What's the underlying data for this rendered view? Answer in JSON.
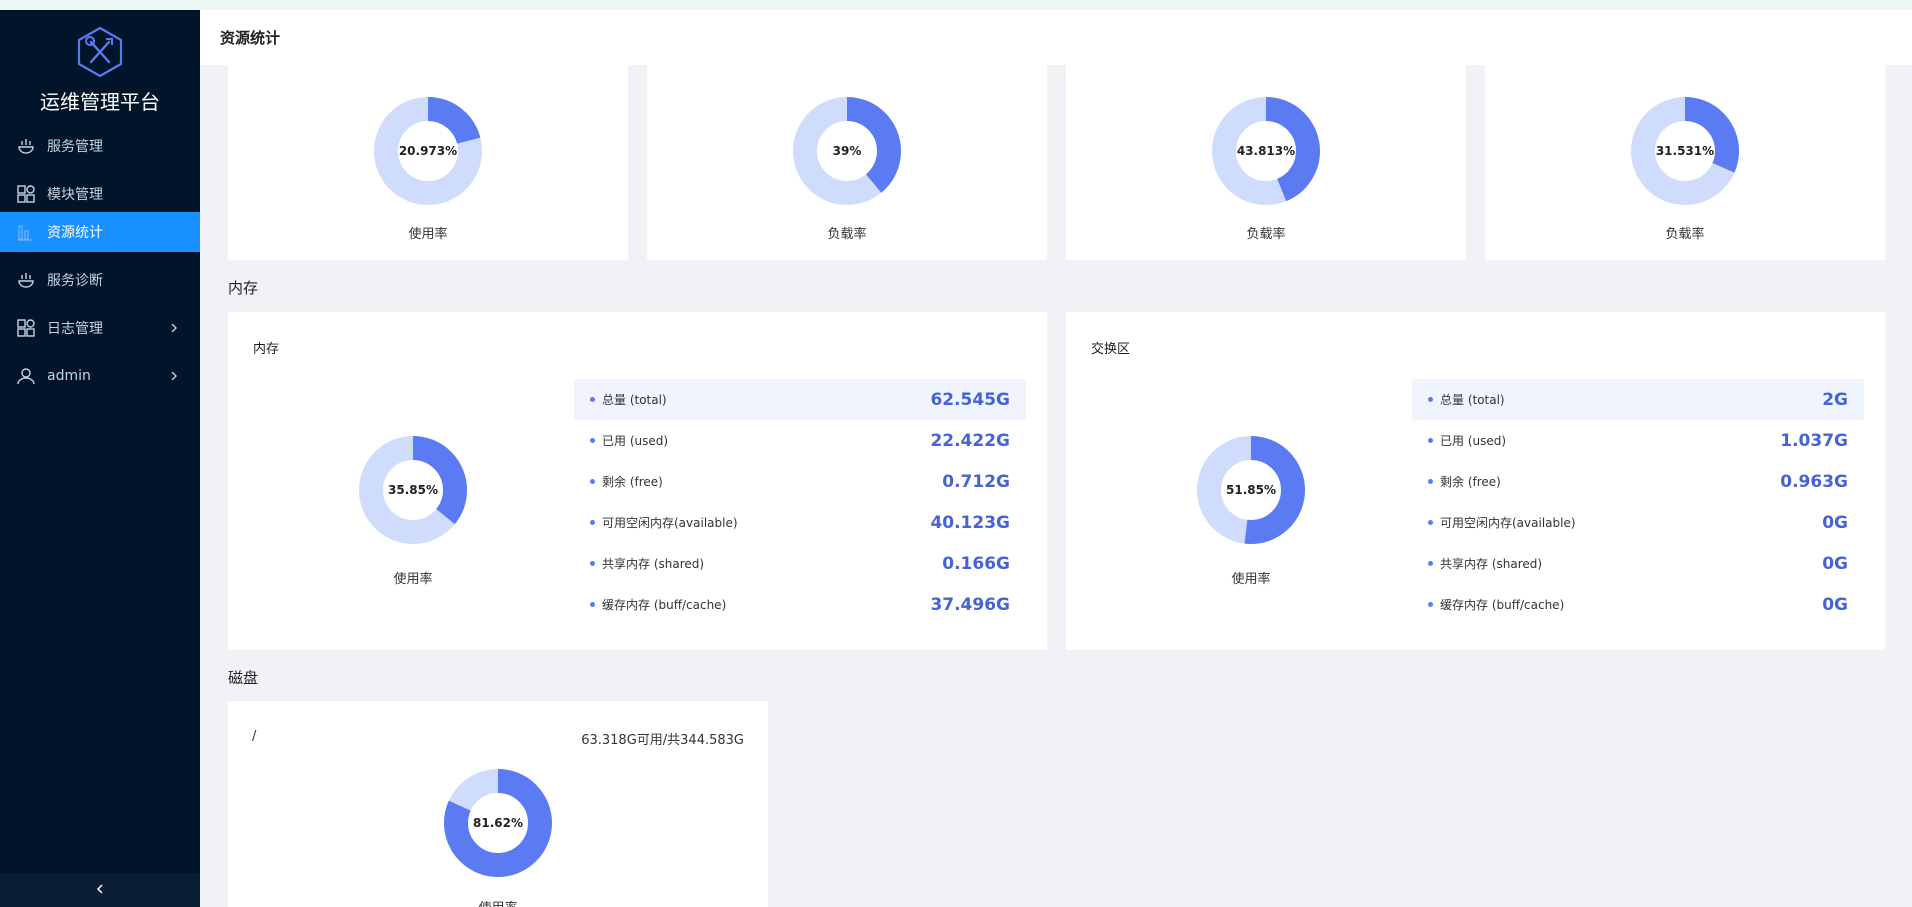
{
  "app": {
    "title": "运维管理平台"
  },
  "sidebar": {
    "items": [
      {
        "label": "服务管理",
        "icon": "service-icon"
      },
      {
        "label": "模块管理",
        "icon": "module-grid-icon"
      },
      {
        "label": "资源统计",
        "icon": "bar-chart-icon",
        "active": true
      },
      {
        "label": "服务诊断",
        "icon": "diagnosis-icon"
      },
      {
        "label": "日志管理",
        "icon": "log-grid-icon",
        "has_children": true
      },
      {
        "label": "admin",
        "icon": "user-icon",
        "has_children": true
      }
    ]
  },
  "header": {
    "title": "资源统计"
  },
  "colors": {
    "primary": "#5b7bf2",
    "track": "#cfdcfb",
    "active_nav": "#1890ff",
    "sidebar_bg": "#001529"
  },
  "top_gauges": [
    {
      "percent": 20.973,
      "text": "20.973%",
      "label": "使用率"
    },
    {
      "percent": 39,
      "text": "39%",
      "label": "负载率"
    },
    {
      "percent": 43.813,
      "text": "43.813%",
      "label": "负载率"
    },
    {
      "percent": 31.531,
      "text": "31.531%",
      "label": "负载率"
    }
  ],
  "memory_section": {
    "title": "内存",
    "memory": {
      "title": "内存",
      "gauge": {
        "percent": 35.85,
        "text": "35.85%",
        "label": "使用率"
      },
      "stats": [
        {
          "label": "总量 (total)",
          "value": "62.545G"
        },
        {
          "label": "已用 (used)",
          "value": "22.422G"
        },
        {
          "label": "剩余 (free)",
          "value": "0.712G"
        },
        {
          "label": "可用空闲内存(available)",
          "value": "40.123G"
        },
        {
          "label": "共享内存 (shared)",
          "value": "0.166G"
        },
        {
          "label": "缓存内存 (buff/cache)",
          "value": "37.496G"
        }
      ]
    },
    "swap": {
      "title": "交换区",
      "gauge": {
        "percent": 51.85,
        "text": "51.85%",
        "label": "使用率"
      },
      "stats": [
        {
          "label": "总量 (total)",
          "value": "2G"
        },
        {
          "label": "已用 (used)",
          "value": "1.037G"
        },
        {
          "label": "剩余 (free)",
          "value": "0.963G"
        },
        {
          "label": "可用空闲内存(available)",
          "value": "0G"
        },
        {
          "label": "共享内存 (shared)",
          "value": "0G"
        },
        {
          "label": "缓存内存 (buff/cache)",
          "value": "0G"
        }
      ]
    }
  },
  "disk_section": {
    "title": "磁盘",
    "disks": [
      {
        "path": "/",
        "info": "63.318G可用/共344.583G",
        "gauge": {
          "percent": 81.62,
          "text": "81.62%",
          "label": "使用率"
        }
      }
    ]
  }
}
